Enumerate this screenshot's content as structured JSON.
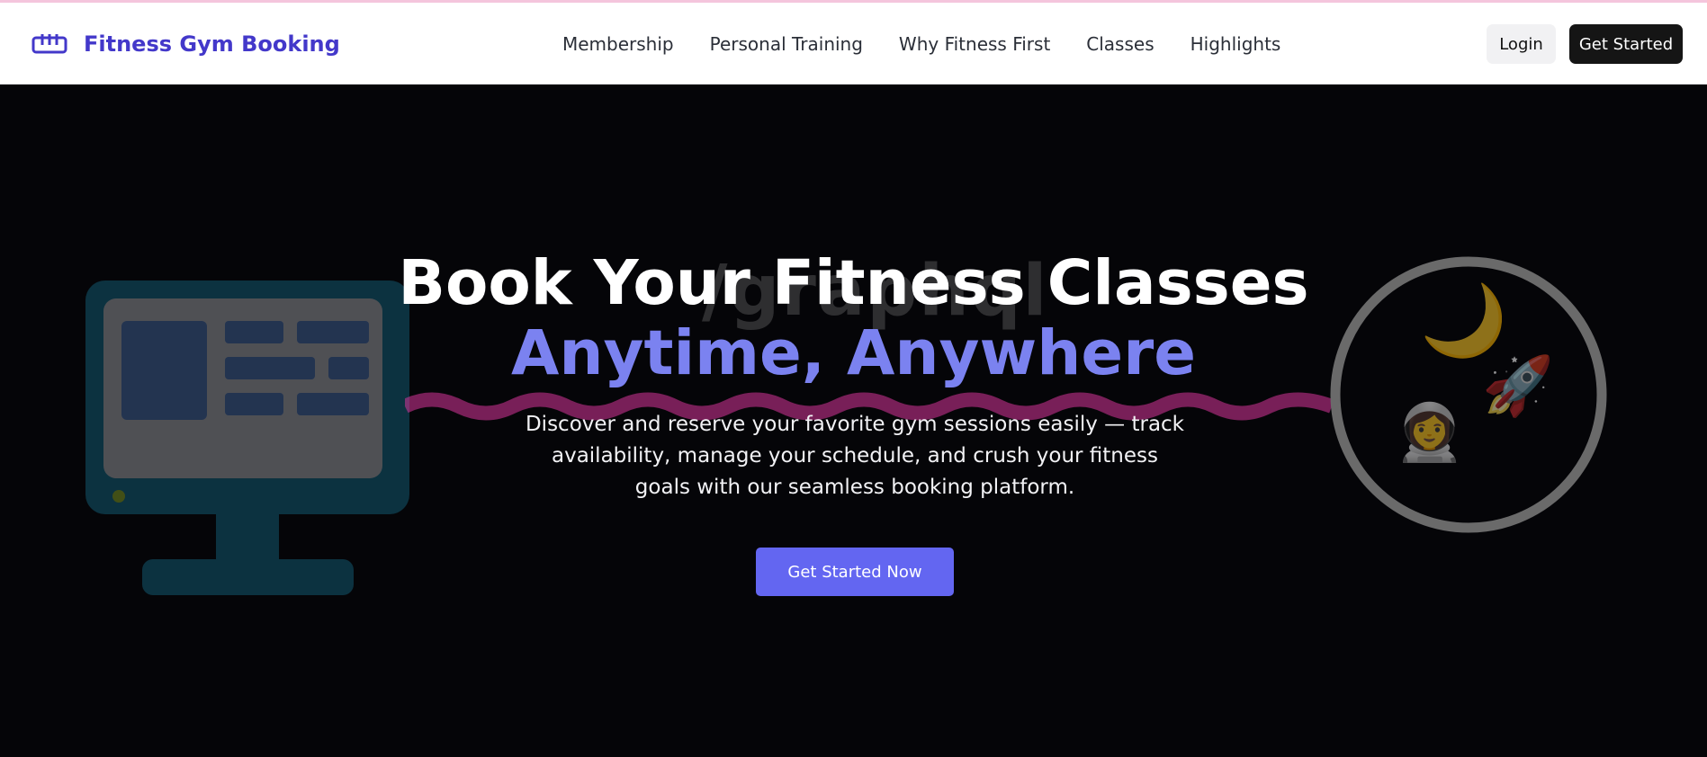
{
  "brand": {
    "name": "Fitness Gym Booking",
    "icon": "dumbbell-icon",
    "color": "#4338ca"
  },
  "nav": {
    "links": [
      "Membership",
      "Personal Training",
      "Why Fitness First",
      "Classes",
      "Highlights"
    ],
    "login_label": "Login",
    "get_started_label": "Get Started"
  },
  "hero": {
    "title": "Book Your Fitness Classes",
    "title_accent": "Anytime, Anywhere",
    "description": "Discover and reserve your favorite gym sessions easily — track availability, manage your schedule, and crush your fitness goals with our seamless booking platform.",
    "cta_label": "Get Started Now",
    "accent_color": "#7b82f0",
    "cta_color": "#6366f1",
    "background_text": "/graphql",
    "decorations": [
      "monitor-icon",
      "wave-graphic",
      "moon-icon",
      "rocket-icon",
      "astronaut-icon"
    ]
  }
}
